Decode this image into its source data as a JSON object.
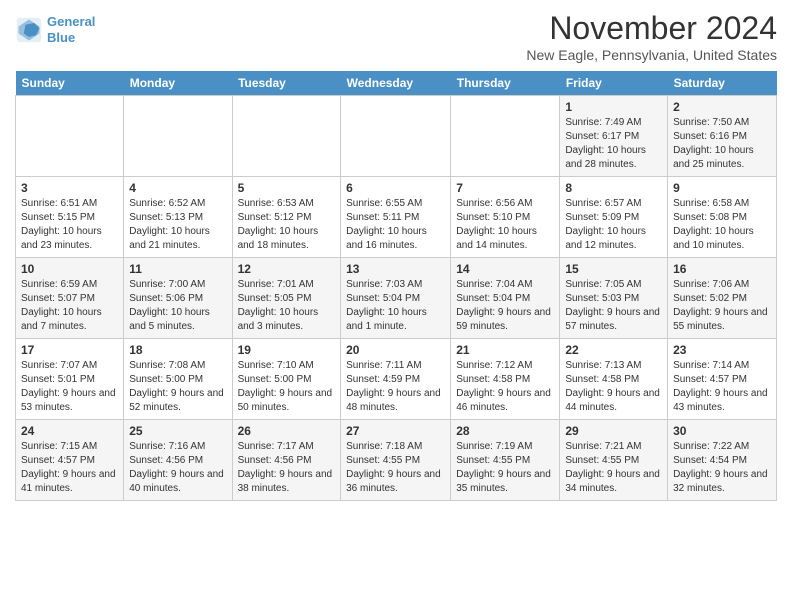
{
  "header": {
    "logo_line1": "General",
    "logo_line2": "Blue",
    "month": "November 2024",
    "location": "New Eagle, Pennsylvania, United States"
  },
  "days_of_week": [
    "Sunday",
    "Monday",
    "Tuesday",
    "Wednesday",
    "Thursday",
    "Friday",
    "Saturday"
  ],
  "weeks": [
    [
      {
        "day": "",
        "info": ""
      },
      {
        "day": "",
        "info": ""
      },
      {
        "day": "",
        "info": ""
      },
      {
        "day": "",
        "info": ""
      },
      {
        "day": "",
        "info": ""
      },
      {
        "day": "1",
        "info": "Sunrise: 7:49 AM\nSunset: 6:17 PM\nDaylight: 10 hours and 28 minutes."
      },
      {
        "day": "2",
        "info": "Sunrise: 7:50 AM\nSunset: 6:16 PM\nDaylight: 10 hours and 25 minutes."
      }
    ],
    [
      {
        "day": "3",
        "info": "Sunrise: 6:51 AM\nSunset: 5:15 PM\nDaylight: 10 hours and 23 minutes."
      },
      {
        "day": "4",
        "info": "Sunrise: 6:52 AM\nSunset: 5:13 PM\nDaylight: 10 hours and 21 minutes."
      },
      {
        "day": "5",
        "info": "Sunrise: 6:53 AM\nSunset: 5:12 PM\nDaylight: 10 hours and 18 minutes."
      },
      {
        "day": "6",
        "info": "Sunrise: 6:55 AM\nSunset: 5:11 PM\nDaylight: 10 hours and 16 minutes."
      },
      {
        "day": "7",
        "info": "Sunrise: 6:56 AM\nSunset: 5:10 PM\nDaylight: 10 hours and 14 minutes."
      },
      {
        "day": "8",
        "info": "Sunrise: 6:57 AM\nSunset: 5:09 PM\nDaylight: 10 hours and 12 minutes."
      },
      {
        "day": "9",
        "info": "Sunrise: 6:58 AM\nSunset: 5:08 PM\nDaylight: 10 hours and 10 minutes."
      }
    ],
    [
      {
        "day": "10",
        "info": "Sunrise: 6:59 AM\nSunset: 5:07 PM\nDaylight: 10 hours and 7 minutes."
      },
      {
        "day": "11",
        "info": "Sunrise: 7:00 AM\nSunset: 5:06 PM\nDaylight: 10 hours and 5 minutes."
      },
      {
        "day": "12",
        "info": "Sunrise: 7:01 AM\nSunset: 5:05 PM\nDaylight: 10 hours and 3 minutes."
      },
      {
        "day": "13",
        "info": "Sunrise: 7:03 AM\nSunset: 5:04 PM\nDaylight: 10 hours and 1 minute."
      },
      {
        "day": "14",
        "info": "Sunrise: 7:04 AM\nSunset: 5:04 PM\nDaylight: 9 hours and 59 minutes."
      },
      {
        "day": "15",
        "info": "Sunrise: 7:05 AM\nSunset: 5:03 PM\nDaylight: 9 hours and 57 minutes."
      },
      {
        "day": "16",
        "info": "Sunrise: 7:06 AM\nSunset: 5:02 PM\nDaylight: 9 hours and 55 minutes."
      }
    ],
    [
      {
        "day": "17",
        "info": "Sunrise: 7:07 AM\nSunset: 5:01 PM\nDaylight: 9 hours and 53 minutes."
      },
      {
        "day": "18",
        "info": "Sunrise: 7:08 AM\nSunset: 5:00 PM\nDaylight: 9 hours and 52 minutes."
      },
      {
        "day": "19",
        "info": "Sunrise: 7:10 AM\nSunset: 5:00 PM\nDaylight: 9 hours and 50 minutes."
      },
      {
        "day": "20",
        "info": "Sunrise: 7:11 AM\nSunset: 4:59 PM\nDaylight: 9 hours and 48 minutes."
      },
      {
        "day": "21",
        "info": "Sunrise: 7:12 AM\nSunset: 4:58 PM\nDaylight: 9 hours and 46 minutes."
      },
      {
        "day": "22",
        "info": "Sunrise: 7:13 AM\nSunset: 4:58 PM\nDaylight: 9 hours and 44 minutes."
      },
      {
        "day": "23",
        "info": "Sunrise: 7:14 AM\nSunset: 4:57 PM\nDaylight: 9 hours and 43 minutes."
      }
    ],
    [
      {
        "day": "24",
        "info": "Sunrise: 7:15 AM\nSunset: 4:57 PM\nDaylight: 9 hours and 41 minutes."
      },
      {
        "day": "25",
        "info": "Sunrise: 7:16 AM\nSunset: 4:56 PM\nDaylight: 9 hours and 40 minutes."
      },
      {
        "day": "26",
        "info": "Sunrise: 7:17 AM\nSunset: 4:56 PM\nDaylight: 9 hours and 38 minutes."
      },
      {
        "day": "27",
        "info": "Sunrise: 7:18 AM\nSunset: 4:55 PM\nDaylight: 9 hours and 36 minutes."
      },
      {
        "day": "28",
        "info": "Sunrise: 7:19 AM\nSunset: 4:55 PM\nDaylight: 9 hours and 35 minutes."
      },
      {
        "day": "29",
        "info": "Sunrise: 7:21 AM\nSunset: 4:55 PM\nDaylight: 9 hours and 34 minutes."
      },
      {
        "day": "30",
        "info": "Sunrise: 7:22 AM\nSunset: 4:54 PM\nDaylight: 9 hours and 32 minutes."
      }
    ]
  ]
}
